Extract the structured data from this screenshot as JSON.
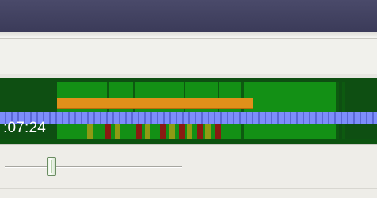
{
  "timeline": {
    "time_label": ":07:24",
    "colors": {
      "track_background": "#0e4f12",
      "clip_green": "#139015",
      "orange_clip": "#e0901a",
      "ruler_blue": "#7d8dfb",
      "marker_olive": "#8f9a14",
      "marker_red": "#8a1a12"
    }
  },
  "zoom_slider": {
    "value_fraction": 0.27
  }
}
